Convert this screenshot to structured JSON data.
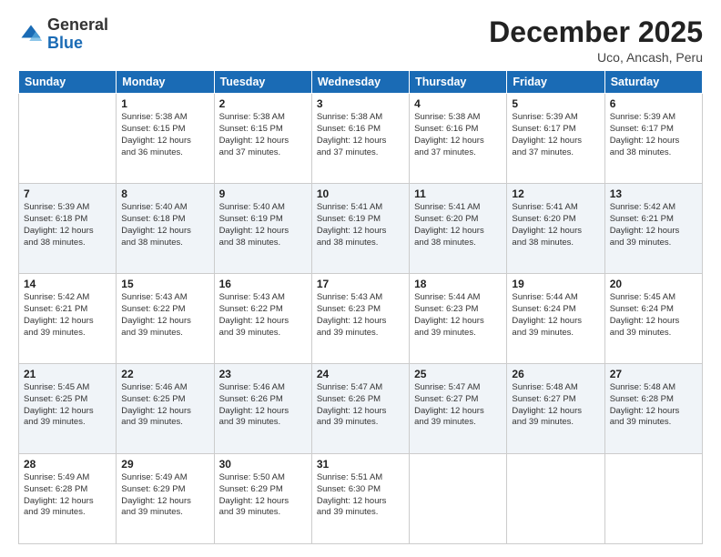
{
  "header": {
    "logo": {
      "general": "General",
      "blue": "Blue"
    },
    "title": "December 2025",
    "location": "Uco, Ancash, Peru"
  },
  "weekdays": [
    "Sunday",
    "Monday",
    "Tuesday",
    "Wednesday",
    "Thursday",
    "Friday",
    "Saturday"
  ],
  "weeks": [
    [
      {
        "day": "",
        "info": ""
      },
      {
        "day": "1",
        "info": "Sunrise: 5:38 AM\nSunset: 6:15 PM\nDaylight: 12 hours\nand 36 minutes."
      },
      {
        "day": "2",
        "info": "Sunrise: 5:38 AM\nSunset: 6:15 PM\nDaylight: 12 hours\nand 37 minutes."
      },
      {
        "day": "3",
        "info": "Sunrise: 5:38 AM\nSunset: 6:16 PM\nDaylight: 12 hours\nand 37 minutes."
      },
      {
        "day": "4",
        "info": "Sunrise: 5:38 AM\nSunset: 6:16 PM\nDaylight: 12 hours\nand 37 minutes."
      },
      {
        "day": "5",
        "info": "Sunrise: 5:39 AM\nSunset: 6:17 PM\nDaylight: 12 hours\nand 37 minutes."
      },
      {
        "day": "6",
        "info": "Sunrise: 5:39 AM\nSunset: 6:17 PM\nDaylight: 12 hours\nand 38 minutes."
      }
    ],
    [
      {
        "day": "7",
        "info": "Sunrise: 5:39 AM\nSunset: 6:18 PM\nDaylight: 12 hours\nand 38 minutes."
      },
      {
        "day": "8",
        "info": "Sunrise: 5:40 AM\nSunset: 6:18 PM\nDaylight: 12 hours\nand 38 minutes."
      },
      {
        "day": "9",
        "info": "Sunrise: 5:40 AM\nSunset: 6:19 PM\nDaylight: 12 hours\nand 38 minutes."
      },
      {
        "day": "10",
        "info": "Sunrise: 5:41 AM\nSunset: 6:19 PM\nDaylight: 12 hours\nand 38 minutes."
      },
      {
        "day": "11",
        "info": "Sunrise: 5:41 AM\nSunset: 6:20 PM\nDaylight: 12 hours\nand 38 minutes."
      },
      {
        "day": "12",
        "info": "Sunrise: 5:41 AM\nSunset: 6:20 PM\nDaylight: 12 hours\nand 38 minutes."
      },
      {
        "day": "13",
        "info": "Sunrise: 5:42 AM\nSunset: 6:21 PM\nDaylight: 12 hours\nand 39 minutes."
      }
    ],
    [
      {
        "day": "14",
        "info": "Sunrise: 5:42 AM\nSunset: 6:21 PM\nDaylight: 12 hours\nand 39 minutes."
      },
      {
        "day": "15",
        "info": "Sunrise: 5:43 AM\nSunset: 6:22 PM\nDaylight: 12 hours\nand 39 minutes."
      },
      {
        "day": "16",
        "info": "Sunrise: 5:43 AM\nSunset: 6:22 PM\nDaylight: 12 hours\nand 39 minutes."
      },
      {
        "day": "17",
        "info": "Sunrise: 5:43 AM\nSunset: 6:23 PM\nDaylight: 12 hours\nand 39 minutes."
      },
      {
        "day": "18",
        "info": "Sunrise: 5:44 AM\nSunset: 6:23 PM\nDaylight: 12 hours\nand 39 minutes."
      },
      {
        "day": "19",
        "info": "Sunrise: 5:44 AM\nSunset: 6:24 PM\nDaylight: 12 hours\nand 39 minutes."
      },
      {
        "day": "20",
        "info": "Sunrise: 5:45 AM\nSunset: 6:24 PM\nDaylight: 12 hours\nand 39 minutes."
      }
    ],
    [
      {
        "day": "21",
        "info": "Sunrise: 5:45 AM\nSunset: 6:25 PM\nDaylight: 12 hours\nand 39 minutes."
      },
      {
        "day": "22",
        "info": "Sunrise: 5:46 AM\nSunset: 6:25 PM\nDaylight: 12 hours\nand 39 minutes."
      },
      {
        "day": "23",
        "info": "Sunrise: 5:46 AM\nSunset: 6:26 PM\nDaylight: 12 hours\nand 39 minutes."
      },
      {
        "day": "24",
        "info": "Sunrise: 5:47 AM\nSunset: 6:26 PM\nDaylight: 12 hours\nand 39 minutes."
      },
      {
        "day": "25",
        "info": "Sunrise: 5:47 AM\nSunset: 6:27 PM\nDaylight: 12 hours\nand 39 minutes."
      },
      {
        "day": "26",
        "info": "Sunrise: 5:48 AM\nSunset: 6:27 PM\nDaylight: 12 hours\nand 39 minutes."
      },
      {
        "day": "27",
        "info": "Sunrise: 5:48 AM\nSunset: 6:28 PM\nDaylight: 12 hours\nand 39 minutes."
      }
    ],
    [
      {
        "day": "28",
        "info": "Sunrise: 5:49 AM\nSunset: 6:28 PM\nDaylight: 12 hours\nand 39 minutes."
      },
      {
        "day": "29",
        "info": "Sunrise: 5:49 AM\nSunset: 6:29 PM\nDaylight: 12 hours\nand 39 minutes."
      },
      {
        "day": "30",
        "info": "Sunrise: 5:50 AM\nSunset: 6:29 PM\nDaylight: 12 hours\nand 39 minutes."
      },
      {
        "day": "31",
        "info": "Sunrise: 5:51 AM\nSunset: 6:30 PM\nDaylight: 12 hours\nand 39 minutes."
      },
      {
        "day": "",
        "info": ""
      },
      {
        "day": "",
        "info": ""
      },
      {
        "day": "",
        "info": ""
      }
    ]
  ]
}
